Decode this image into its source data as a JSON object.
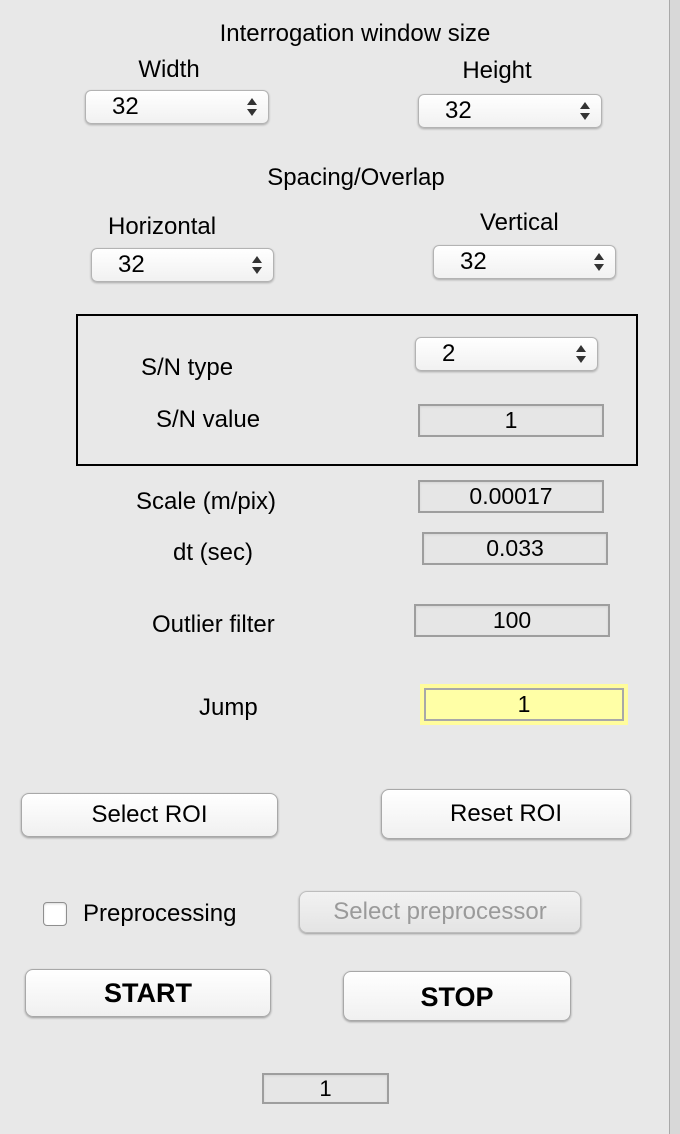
{
  "window": {
    "title": "Interrogation window size",
    "width_label": "Width",
    "height_label": "Height",
    "width_value": "32",
    "height_value": "32"
  },
  "spacing": {
    "title": "Spacing/Overlap",
    "horizontal_label": "Horizontal",
    "vertical_label": "Vertical",
    "horizontal_value": "32",
    "vertical_value": "32"
  },
  "sn": {
    "type_label": "S/N type",
    "type_value": "2",
    "value_label": "S/N value",
    "value": "1"
  },
  "params": {
    "scale_label": "Scale (m/pix)",
    "scale_value": "0.00017",
    "dt_label": "dt (sec)",
    "dt_value": "0.033",
    "outlier_label": "Outlier filter",
    "outlier_value": "100",
    "jump_label": "Jump",
    "jump_value": "1"
  },
  "roi": {
    "select_label": "Select ROI",
    "reset_label": "Reset ROI"
  },
  "preprocessing": {
    "checkbox_label": "Preprocessing",
    "checked": false,
    "select_label": "Select preprocessor"
  },
  "controls": {
    "start_label": "START",
    "stop_label": "STOP"
  },
  "status": {
    "counter": "1"
  },
  "icons": {
    "popup_arrows": "up-down-arrows-icon"
  },
  "colors": {
    "background": "#e8e8e8",
    "highlight": "#ffffa6",
    "disabled_text": "#9a9a9a"
  }
}
